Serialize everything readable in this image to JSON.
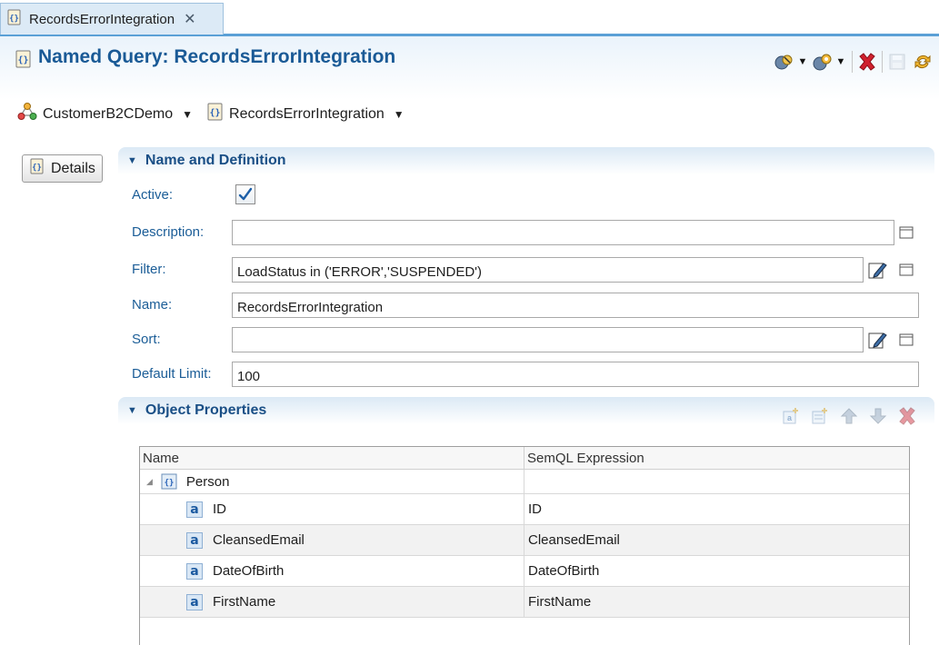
{
  "tab": {
    "title": "RecordsErrorIntegration",
    "close_glyph": "✕"
  },
  "header": {
    "title": "Named Query: RecordsErrorIntegration"
  },
  "toolbar": {
    "icons": [
      "validate-icon",
      "deploy-icon",
      "delete-icon",
      "save-icon",
      "refresh-icon"
    ],
    "dropdown_glyph": "▼"
  },
  "breadcrumb": {
    "items": [
      {
        "label": "CustomerB2CDemo",
        "icon": "model-icon"
      },
      {
        "label": "RecordsErrorIntegration",
        "icon": "named-query-icon"
      }
    ],
    "dropdown_glyph": "▼"
  },
  "details_button": {
    "label": "Details"
  },
  "sections": {
    "name_definition": {
      "title": "Name and Definition",
      "toggle": "▼"
    },
    "object_properties": {
      "title": "Object Properties",
      "toggle": "▼"
    }
  },
  "form": {
    "active_label": "Active:",
    "active_checked": true,
    "description_label": "Description:",
    "description_value": "",
    "filter_label": "Filter:",
    "filter_value": "LoadStatus in ('ERROR','SUSPENDED')",
    "name_label": "Name:",
    "name_value": "RecordsErrorIntegration",
    "sort_label": "Sort:",
    "sort_value": "",
    "limit_label": "Default Limit:",
    "limit_value": "100"
  },
  "table": {
    "headers": [
      "Name",
      "SemQL Expression"
    ],
    "parent": {
      "name": "Person",
      "expression": "",
      "expander": "◢"
    },
    "attr_glyph": "a",
    "rows": [
      {
        "name": "ID",
        "expression": "ID"
      },
      {
        "name": "CleansedEmail",
        "expression": "CleansedEmail"
      },
      {
        "name": "DateOfBirth",
        "expression": "DateOfBirth"
      },
      {
        "name": "FirstName",
        "expression": "FirstName"
      }
    ]
  },
  "colors": {
    "accent": "#1a5a96",
    "label": "#1b5d97",
    "tab_border": "#5aa0d6",
    "delete": "#c8182a"
  }
}
